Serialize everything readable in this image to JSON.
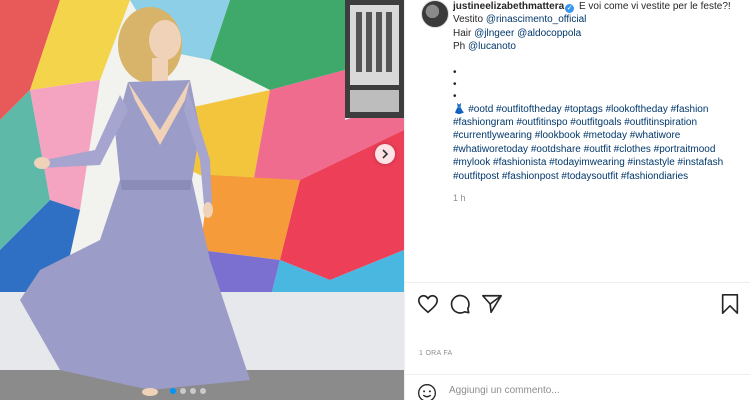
{
  "post": {
    "username": "justineelizabethmattera",
    "caption_first": "E voi come vi vestite per le feste?!",
    "lines": [
      {
        "prefix": "Vestito ",
        "tag": "@rinascimento_official"
      },
      {
        "prefix": "Hair ",
        "tag": "@jlngeer @aldocoppola"
      },
      {
        "prefix": "Ph ",
        "tag": "@lucanoto"
      }
    ],
    "bullets": [
      "•",
      "•",
      "•"
    ],
    "dress_emoji": "👗",
    "hashtag_lines": [
      "#ootd #outfitoftheday #toptags #lookoftheday #fashion",
      "#fashiongram #outfitinspo #outfitgoals #outfitinspiration",
      "#currentlywearing #lookbook #metoday #whatiwore",
      "#whatiworetoday #ootdshare #outfit #clothes #portraitmood",
      "#mylook #fashionista #todayimwearing #instastyle #instafash",
      "#outfitpost #fashionpost #todaysoutfit #fashiondiaries"
    ],
    "caption_time": "1 h",
    "post_time": "1 ORA FA",
    "comment_placeholder": "Aggiungi un commento..."
  },
  "icons": {
    "like": "heart-icon",
    "comment": "comment-icon",
    "share": "paper-plane-icon",
    "save": "bookmark-icon",
    "emoji": "smiley-icon",
    "next": "chevron-right-icon"
  },
  "colors": {
    "text": "#262626",
    "link": "#00376b",
    "muted": "#8e8e8e",
    "verified": "#3897f0",
    "active_dot": "#0095f6"
  },
  "carousel": {
    "count": 4,
    "active": 1
  }
}
